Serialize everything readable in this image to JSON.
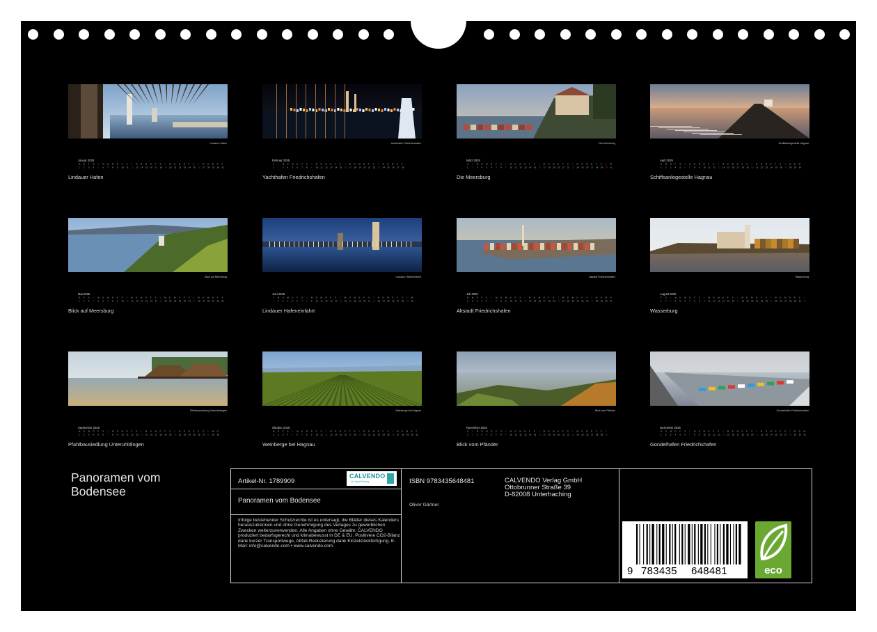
{
  "calendar_title_lines": [
    "Panoramen vom",
    "Bodensee"
  ],
  "months": [
    {
      "month_label": "Januar 2025",
      "photo_caption": "Lindauer Hafen",
      "title": "Lindauer Hafen",
      "scene": "tree"
    },
    {
      "month_label": "Februar 2025",
      "photo_caption": "Yachthafen Friedrichshafen",
      "title": "Yachthafen Friedrichshafen",
      "scene": "night"
    },
    {
      "month_label": "März 2025",
      "photo_caption": "Die Meersburg",
      "title": "Die Meersburg",
      "scene": "castle"
    },
    {
      "month_label": "April 2025",
      "photo_caption": "Schiffsanlegestelle Hagnau",
      "title": "Schiffsanlegestelle Hagnau",
      "scene": "pier"
    },
    {
      "month_label": "Mai 2025",
      "photo_caption": "Blick auf Meersburg",
      "title": "Blick auf Meersburg",
      "scene": "vineyard_lake"
    },
    {
      "month_label": "Juni 2025",
      "photo_caption": "Lindauer Hafeneinfahrt",
      "title": "Lindauer Hafeneinfahrt",
      "scene": "harbor_blue"
    },
    {
      "month_label": "Juli 2025",
      "photo_caption": "Altstadt Friedrichshafen",
      "title": "Altstadt Friedrichshafen",
      "scene": "town_aerial"
    },
    {
      "month_label": "August 2025",
      "photo_caption": "Wasserburg",
      "title": "Wasserburg",
      "scene": "wasserburg"
    },
    {
      "month_label": "September 2025",
      "photo_caption": "Pfahlbausiedlung Unteruhldingen",
      "title": "Pfahlbausiedlung Unteruhldingen",
      "scene": "stilt"
    },
    {
      "month_label": "Oktober 2025",
      "photo_caption": "Weinberge bei Hagnau",
      "title": "Weinberge bei Hagnau",
      "scene": "rows"
    },
    {
      "month_label": "November 2025",
      "photo_caption": "Blick vom Pfänder",
      "title": "Blick vom Pfänder",
      "scene": "pfaender"
    },
    {
      "month_label": "Dezember 2025",
      "photo_caption": "Gondelhafen Friedrichshafen",
      "title": "Gondelhafen Friedrichshafen",
      "scene": "gondel"
    }
  ],
  "info": {
    "article": "Artikel-Nr. 1789909",
    "brand": "CALVENDO",
    "brand_tagline": "ein Apple/Verlag",
    "book_title": "Panoramen vom Bodensee",
    "legal_text": "Infolge bestehender Schutzrechte ist es untersagt, die Blätter dieses Kalenders herauszutrennen und ohne Genehmigung des Verlages zu gewerblichen Zwecken weiterzuverwenden. Alle Angaben ohne Gewähr. CALVENDO produziert bedarfsgerecht und klimabewusst in DE & EU. Positivere CO2-Bilanz dank kurzer Transportwege, Abfall-Reduzierung dank Einzelstückfertigung. E-Mail: info@calvendo.com • www.calvendo.com",
    "isbn": "ISBN 9783435648481",
    "author": "Oliver Gärtner",
    "publisher_lines": [
      "CALVENDO Verlag GmbH",
      "Ottobrunner Straße 39",
      "D-82008 Unterhaching"
    ],
    "barcode_digits": [
      "9",
      "783435",
      "648481"
    ],
    "eco_label": "eco"
  },
  "colors": {
    "sheet": "#000000",
    "sunday": "#cc2222",
    "eco_green": "#6aa832",
    "calvendo_teal": "#2fa6a8"
  }
}
